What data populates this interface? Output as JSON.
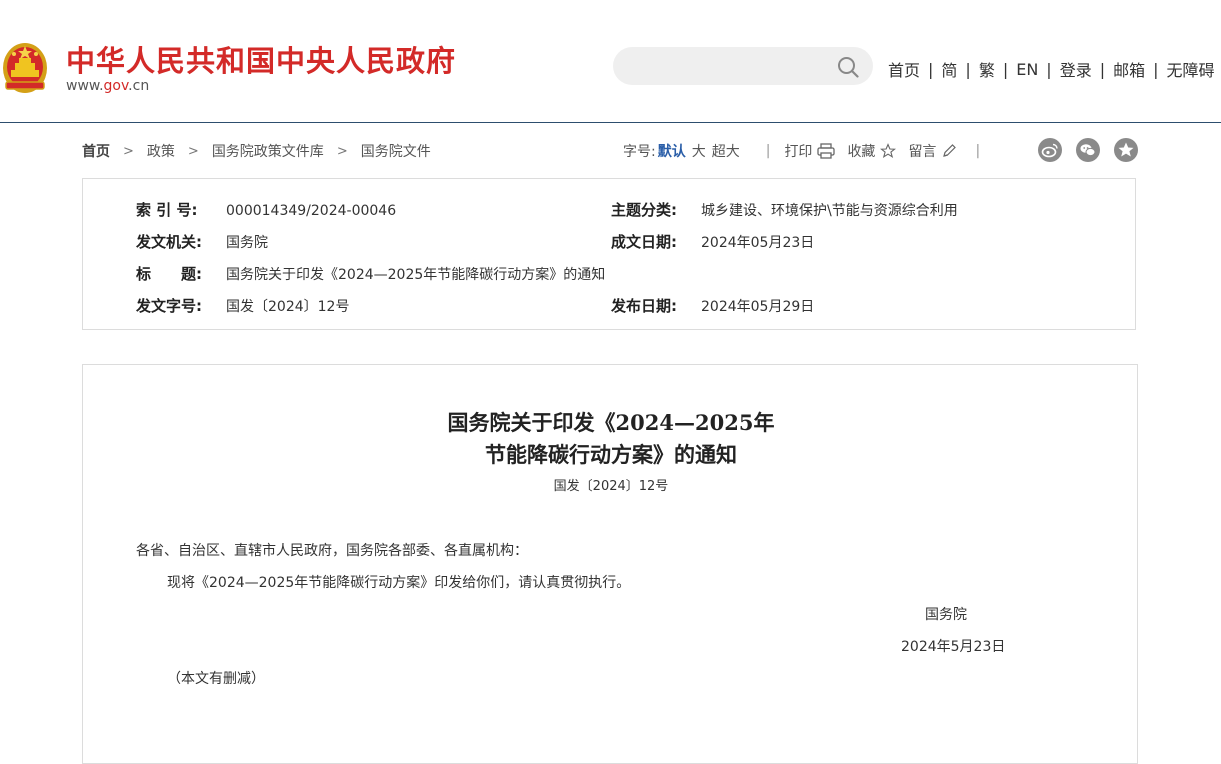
{
  "header": {
    "site_title": "中华人民共和国中央人民政府",
    "site_url_prefix": "www.",
    "site_url_brand": "gov",
    "site_url_suffix": ".cn",
    "search_placeholder": "",
    "nav": [
      "首页",
      "简",
      "繁",
      "EN",
      "登录",
      "邮箱",
      "无障碍"
    ],
    "nav_separator": "|"
  },
  "breadcrumb": {
    "items": [
      "首页",
      "政策",
      "国务院政策文件库",
      "国务院文件"
    ],
    "arrow": ">"
  },
  "toolbar": {
    "font_size_label": "字号:",
    "font_sizes": [
      "默认",
      "大",
      "超大"
    ],
    "separator": "|",
    "print_label": "打印",
    "favorite_label": "收藏",
    "comment_label": "留言",
    "share_icons": [
      "weibo-icon",
      "wechat-icon",
      "qzone-icon"
    ]
  },
  "info": {
    "index_label": "索 引 号:",
    "index_value": "000014349/2024-00046",
    "topic_label": "主题分类:",
    "topic_value": "城乡建设、环境保护\\节能与资源综合利用",
    "issuer_label": "发文机关:",
    "issuer_value": "国务院",
    "created_label": "成文日期:",
    "created_value": "2024年05月23日",
    "title_label": "标　　题:",
    "title_value": "国务院关于印发《2024—2025年节能降碳行动方案》的通知",
    "docno_label": "发文字号:",
    "docno_value": "国发〔2024〕12号",
    "published_label": "发布日期:",
    "published_value": "2024年05月29日"
  },
  "document": {
    "title_line1": "国务院关于印发《2024—2025年",
    "title_line2": "节能降碳行动方案》的通知",
    "doc_number": "国发〔2024〕12号",
    "salutation": "各省、自治区、直辖市人民政府，国务院各部委、各直属机构：",
    "body": "现将《2024—2025年节能降碳行动方案》印发给你们，请认真贯彻执行。",
    "signature": "国务院",
    "date": "2024年5月23日",
    "note": "（本文有删减）"
  },
  "colors": {
    "brand_red": "#d32a28",
    "header_rule": "#2d4e6e",
    "active_font_size": "#2a5ea8"
  }
}
